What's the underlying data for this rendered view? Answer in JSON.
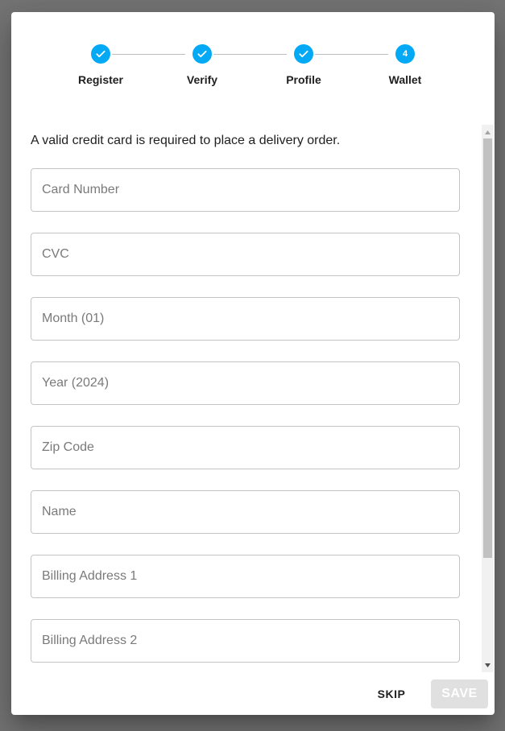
{
  "stepper": {
    "steps": [
      {
        "label": "Register",
        "state": "complete",
        "icon": "check-icon"
      },
      {
        "label": "Verify",
        "state": "complete",
        "icon": "check-icon"
      },
      {
        "label": "Profile",
        "state": "complete",
        "icon": "check-icon"
      },
      {
        "label": "Wallet",
        "state": "active",
        "number": "4"
      }
    ],
    "accent_color": "#03a9f4"
  },
  "form": {
    "intro": "A valid credit card is required to place a delivery order.",
    "fields": [
      {
        "placeholder": "Card Number",
        "value": ""
      },
      {
        "placeholder": "CVC",
        "value": ""
      },
      {
        "placeholder": "Month (01)",
        "value": ""
      },
      {
        "placeholder": "Year (2024)",
        "value": ""
      },
      {
        "placeholder": "Zip Code",
        "value": ""
      },
      {
        "placeholder": "Name",
        "value": ""
      },
      {
        "placeholder": "Billing Address 1",
        "value": ""
      },
      {
        "placeholder": "Billing Address 2",
        "value": ""
      }
    ]
  },
  "actions": {
    "skip_label": "SKIP",
    "save_label": "SAVE",
    "save_disabled": true
  }
}
